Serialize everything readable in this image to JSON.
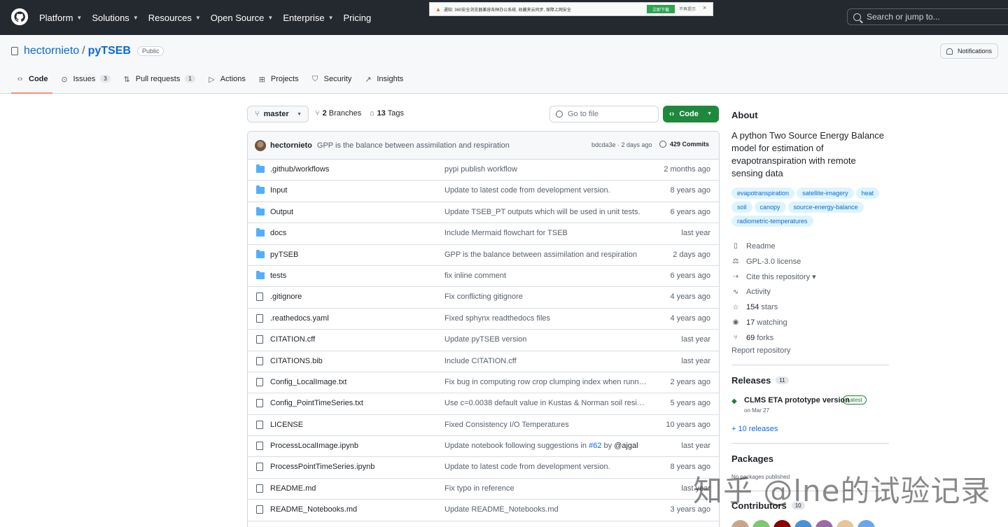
{
  "nav": {
    "items": [
      {
        "label": "Platform",
        "chevron": true
      },
      {
        "label": "Solutions",
        "chevron": true
      },
      {
        "label": "Resources",
        "chevron": true
      },
      {
        "label": "Open Source",
        "chevron": true
      },
      {
        "label": "Enterprise",
        "chevron": true
      },
      {
        "label": "Pricing",
        "chevron": false
      }
    ],
    "search_placeholder": "Search or jump to..."
  },
  "banner": {
    "text": "通知: 360安全浏览器兼容各种办公系统, 收藏夹云同步, 保障上网安全",
    "download_label": "立即下载",
    "dismiss_label": "不再提示",
    "close_glyph": "×"
  },
  "repo": {
    "owner": "hectornieto",
    "name": "pyTSEB",
    "visibility": "Public",
    "notifications_label": "Notifications"
  },
  "tabs": [
    {
      "label": "Code",
      "icon": "code-icon",
      "glyph": "‹›",
      "count": null,
      "active": true
    },
    {
      "label": "Issues",
      "icon": "issue-icon",
      "glyph": "⊙",
      "count": "3",
      "active": false
    },
    {
      "label": "Pull requests",
      "icon": "pull-request-icon",
      "glyph": "⇅",
      "count": "1",
      "active": false
    },
    {
      "label": "Actions",
      "icon": "play-icon",
      "glyph": "▷",
      "count": null,
      "active": false
    },
    {
      "label": "Projects",
      "icon": "table-icon",
      "glyph": "⊞",
      "count": null,
      "active": false
    },
    {
      "label": "Security",
      "icon": "shield-icon",
      "glyph": "⛉",
      "count": null,
      "active": false
    },
    {
      "label": "Insights",
      "icon": "graph-icon",
      "glyph": "↗",
      "count": null,
      "active": false
    }
  ],
  "browser": {
    "branch": "master",
    "branches_count": "2",
    "branches_label": "Branches",
    "tags_count": "13",
    "tags_label": "Tags",
    "goto_placeholder": "Go to file",
    "code_button": "Code"
  },
  "commit": {
    "author": "hectornieto",
    "message": "GPP is the balance between assimilation and respiration",
    "meta": "bdcda3e · 2 days ago",
    "commits": "429 Commits"
  },
  "files": [
    {
      "name": ".github/workflows",
      "type": "folder",
      "message": "pypi publish workflow",
      "date": "2 months ago"
    },
    {
      "name": "Input",
      "type": "folder",
      "message": "Update to latest code from development version.",
      "date": "8 years ago"
    },
    {
      "name": "Output",
      "type": "folder",
      "message": "Update TSEB_PT outputs which will be used in unit tests.",
      "date": "6 years ago"
    },
    {
      "name": "docs",
      "type": "folder",
      "message": "Include Mermaid flowchart for TSEB",
      "date": "last year"
    },
    {
      "name": "pyTSEB",
      "type": "folder",
      "message": "GPP is the balance between assimilation and respiration",
      "date": "2 days ago"
    },
    {
      "name": "tests",
      "type": "folder",
      "message": "fix inline comment",
      "date": "6 years ago"
    },
    {
      "name": ".gitignore",
      "type": "file",
      "message": "Fix conflicting gitignore",
      "date": "4 years ago"
    },
    {
      "name": ".reathedocs.yaml",
      "type": "file",
      "message": "Fixed sphynx readthedocs files",
      "date": "4 years ago"
    },
    {
      "name": "CITATION.cff",
      "type": "file",
      "message": "Update pyTSEB version",
      "date": "last year"
    },
    {
      "name": "CITATIONS.bib",
      "type": "file",
      "message": "Include CITATION.cff",
      "date": "last year"
    },
    {
      "name": "Config_LocalImage.txt",
      "type": "file",
      "message": "Fix bug in computing row crop clumping index when running...",
      "date": "2 years ago"
    },
    {
      "name": "Config_PointTimeSeries.txt",
      "type": "file",
      "message": "Use c=0.0038 default value in Kustas & Norman soil resistance",
      "date": "5 years ago"
    },
    {
      "name": "LICENSE",
      "type": "file",
      "message": "Fixed Consistency I/O Temperatures",
      "date": "10 years ago"
    },
    {
      "name": "ProcessLocalImage.ipynb",
      "type": "file",
      "message": "Update notebook following suggestions in",
      "message_link": "#62",
      "message_by": "by",
      "message_user": "@ajgal",
      "date": "last year"
    },
    {
      "name": "ProcessPointTimeSeries.ipynb",
      "type": "file",
      "message": "Update to latest code from development version.",
      "date": "8 years ago"
    },
    {
      "name": "README.md",
      "type": "file",
      "message": "Fix typo in reference",
      "date": "last year"
    },
    {
      "name": "README_Notebooks.md",
      "type": "file",
      "message": "Update README_Notebooks.md",
      "date": "3 years ago"
    }
  ],
  "about": {
    "title": "About",
    "description": "A python Two Source Energy Balance model for estimation of evapotranspiration with remote sensing data",
    "topics": [
      "evapotranspiration",
      "satellite-imagery",
      "heat",
      "soil",
      "canopy",
      "source-energy-balance",
      "radiometric-temperatures"
    ],
    "meta": [
      {
        "icon": "book-icon",
        "glyph": "▯",
        "count": "",
        "label": "Readme"
      },
      {
        "icon": "law-icon",
        "glyph": "⚖",
        "count": "",
        "label": "GPL-3.0 license"
      },
      {
        "icon": "cite-icon",
        "glyph": "⇢",
        "count": "",
        "label": "Cite this repository ▾"
      },
      {
        "icon": "pulse-icon",
        "glyph": "∿",
        "count": "",
        "label": "Activity"
      },
      {
        "icon": "star-icon",
        "glyph": "☆",
        "count": "154",
        "label": "stars"
      },
      {
        "icon": "eye-icon",
        "glyph": "◉",
        "count": "17",
        "label": "watching"
      },
      {
        "icon": "fork-icon",
        "glyph": "⑂",
        "count": "69",
        "label": "forks"
      }
    ],
    "report": "Report repository"
  },
  "releases": {
    "title": "Releases",
    "count": "11",
    "latest_name": "CLMS ETA prototype version",
    "latest_badge": "Latest",
    "latest_date": "on Mar 27",
    "more": "+ 10 releases"
  },
  "packages": {
    "title": "Packages",
    "empty": "No packages published"
  },
  "contributors": {
    "title": "Contributors",
    "count": "10",
    "avatar_colors": [
      "#c8a58a",
      "#7bc96f",
      "#8b0000",
      "#4a90d9",
      "#9b6ba8",
      "#e8c49a",
      "#6aa7e8"
    ]
  },
  "watermark": "知乎 @lne的试验记录"
}
